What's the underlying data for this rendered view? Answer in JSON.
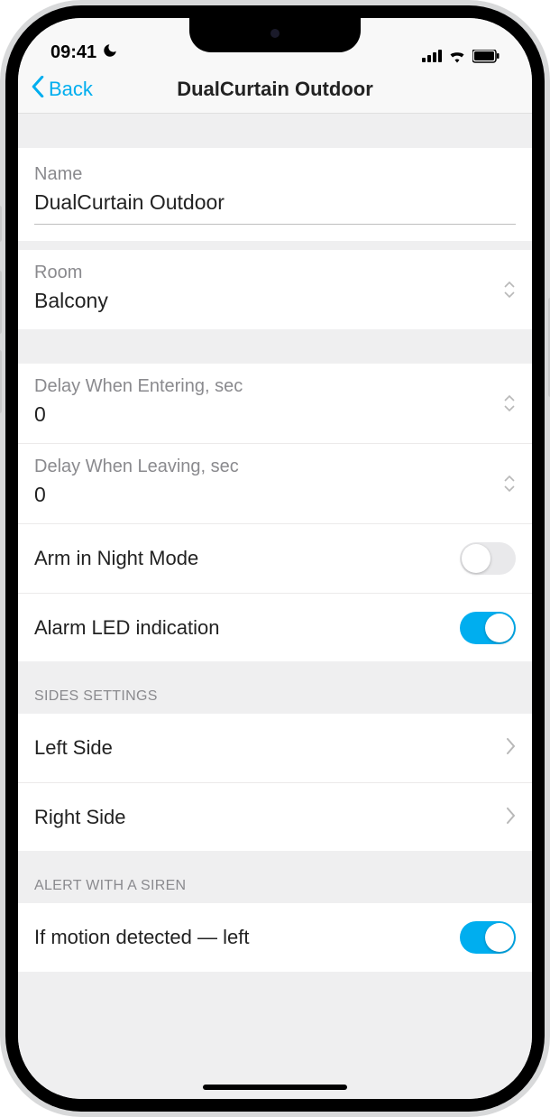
{
  "status": {
    "time": "09:41"
  },
  "nav": {
    "back": "Back",
    "title": "DualCurtain Outdoor"
  },
  "fields": {
    "name_label": "Name",
    "name_value": "DualCurtain Outdoor",
    "room_label": "Room",
    "room_value": "Balcony",
    "delay_enter_label": "Delay When Entering, sec",
    "delay_enter_value": "0",
    "delay_leave_label": "Delay When Leaving, sec",
    "delay_leave_value": "0",
    "arm_night": "Arm in Night Mode",
    "alarm_led": "Alarm LED indication"
  },
  "sections": {
    "sides_header": "SIDES SETTINGS",
    "left_side": "Left Side",
    "right_side": "Right Side",
    "alert_header": "ALERT WITH A SIREN",
    "motion_left": "If motion detected — left"
  },
  "toggles": {
    "arm_night": false,
    "alarm_led": true,
    "motion_left": true
  }
}
